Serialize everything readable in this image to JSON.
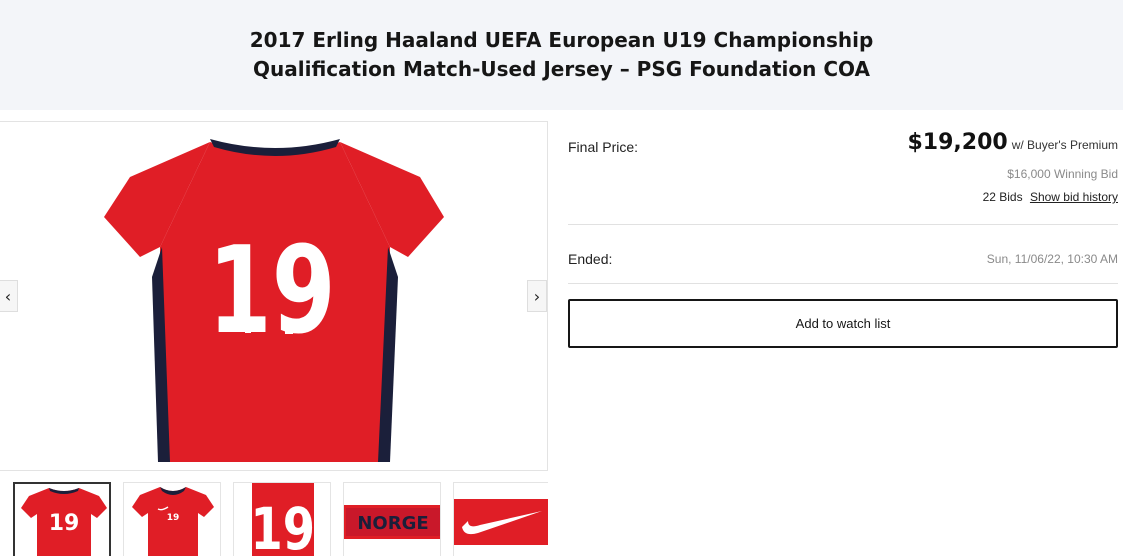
{
  "listing": {
    "title_line1": "2017 Erling Haaland UEFA European U19 Championship",
    "title_line2": "Qualification Match-Used Jersey – PSG Foundation COA"
  },
  "gallery": {
    "jersey_number": "19",
    "prev_arrow": "‹",
    "next_arrow": "›",
    "thumbnails": [
      {
        "kind": "jersey-back",
        "text": "19"
      },
      {
        "kind": "jersey-front",
        "text": "19"
      },
      {
        "kind": "number-closeup",
        "text": "19"
      },
      {
        "kind": "collar-text-closeup",
        "text": "NORGE"
      },
      {
        "kind": "swoosh-closeup",
        "text": ""
      }
    ]
  },
  "details": {
    "final_price_label": "Final Price:",
    "final_price": "$19,200",
    "premium_note": "w/ Buyer's Premium",
    "winning_bid": "$16,000 Winning Bid",
    "bids_count": "22 Bids",
    "bid_history_link": "Show bid history",
    "ended_label": "Ended:",
    "ended_date": "Sun, 11/06/22, 10:30 AM",
    "watch_button": "Add to watch list"
  },
  "colors": {
    "header_bg": "#f3f5f9",
    "jersey_red": "#e01e26",
    "jersey_navy": "#1b1f3a"
  },
  "icons": {
    "prev": "chevron-left-icon",
    "next": "chevron-right-icon",
    "swoosh": "swoosh-logo"
  }
}
